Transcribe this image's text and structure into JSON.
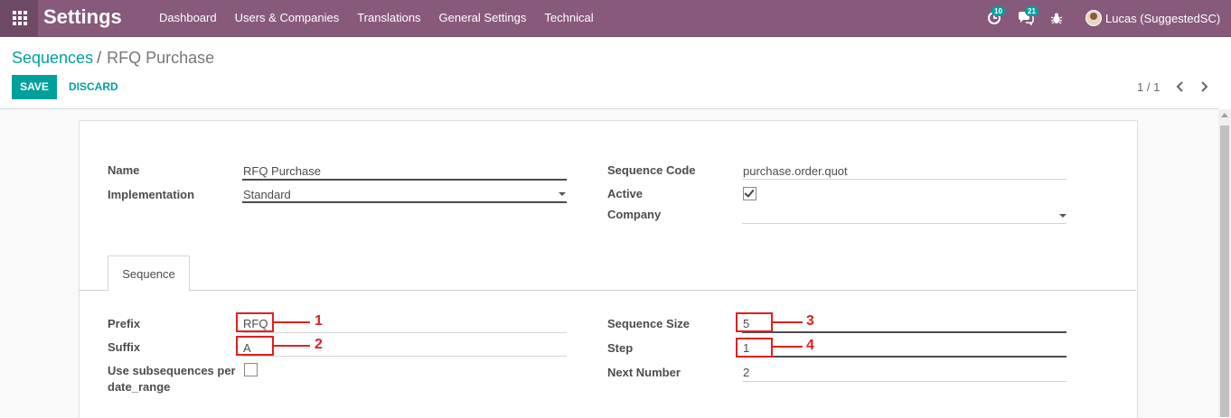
{
  "navbar": {
    "app_title": "Settings",
    "menu": [
      "Dashboard",
      "Users & Companies",
      "Translations",
      "General Settings",
      "Technical"
    ],
    "activity_count": "10",
    "messages_count": "21",
    "user_name": "Lucas (SuggestedSC)"
  },
  "breadcrumb": {
    "parent": "Sequences",
    "separator": "/",
    "current": "RFQ Purchase"
  },
  "buttons": {
    "save": "SAVE",
    "discard": "DISCARD"
  },
  "pager": {
    "value": "1 / 1"
  },
  "form": {
    "name_label": "Name",
    "name_value": "RFQ Purchase",
    "implementation_label": "Implementation",
    "implementation_value": "Standard",
    "code_label": "Sequence Code",
    "code_value": "purchase.order.quot",
    "active_label": "Active",
    "active_checked": true,
    "company_label": "Company",
    "company_value": ""
  },
  "tabs": {
    "sequence": "Sequence"
  },
  "sequence_tab": {
    "prefix_label": "Prefix",
    "prefix_value": "RFQ",
    "suffix_label": "Suffix",
    "suffix_value": "A",
    "subseq_label_line1": "Use subsequences per",
    "subseq_label_line2": "date_range",
    "subseq_checked": false,
    "size_label": "Sequence Size",
    "size_value": "5",
    "step_label": "Step",
    "step_value": "1",
    "next_label": "Next Number",
    "next_value": "2"
  },
  "annotations": [
    "1",
    "2",
    "3",
    "4"
  ],
  "colors": {
    "brand": "#875a7b",
    "accent": "#00a09d",
    "annotation": "#e02020"
  },
  "icons": [
    "apps-grid-icon",
    "activity-clock-icon",
    "chat-bubbles-icon",
    "bug-icon",
    "chevron-left-icon",
    "chevron-right-icon"
  ]
}
